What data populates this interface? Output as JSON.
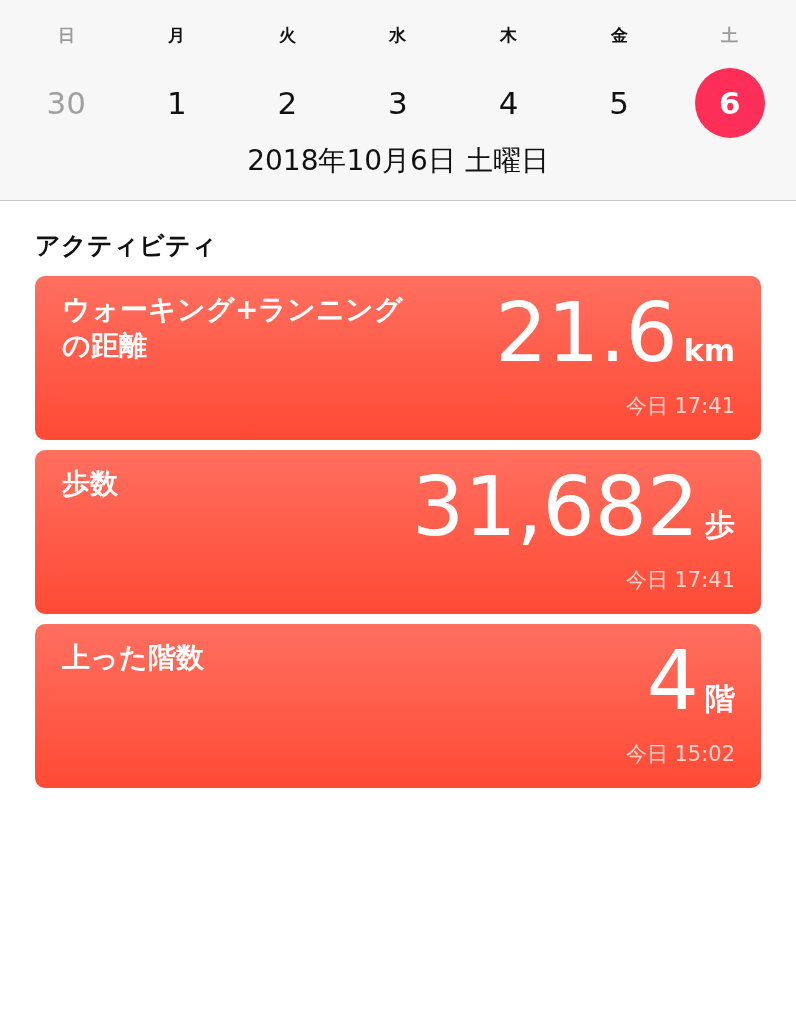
{
  "week": [
    {
      "weekday": "日",
      "weekend": true,
      "date": "30",
      "other_month": true,
      "selected": false
    },
    {
      "weekday": "月",
      "weekend": false,
      "date": "1",
      "other_month": false,
      "selected": false
    },
    {
      "weekday": "火",
      "weekend": false,
      "date": "2",
      "other_month": false,
      "selected": false
    },
    {
      "weekday": "水",
      "weekend": false,
      "date": "3",
      "other_month": false,
      "selected": false
    },
    {
      "weekday": "木",
      "weekend": false,
      "date": "4",
      "other_month": false,
      "selected": false
    },
    {
      "weekday": "金",
      "weekend": false,
      "date": "5",
      "other_month": false,
      "selected": false
    },
    {
      "weekday": "土",
      "weekend": true,
      "date": "6",
      "other_month": false,
      "selected": true
    }
  ],
  "selected_date": "2018年10月6日 土曜日",
  "section_title": "アクティビティ",
  "cards": [
    {
      "title": "ウォーキング+ランニングの距離",
      "value": "21.6",
      "unit": "km",
      "time": "今日 17:41"
    },
    {
      "title": "歩数",
      "value": "31,682",
      "unit": "歩",
      "time": "今日 17:41"
    },
    {
      "title": "上った階数",
      "value": "4",
      "unit": "階",
      "time": "今日 15:02"
    }
  ]
}
